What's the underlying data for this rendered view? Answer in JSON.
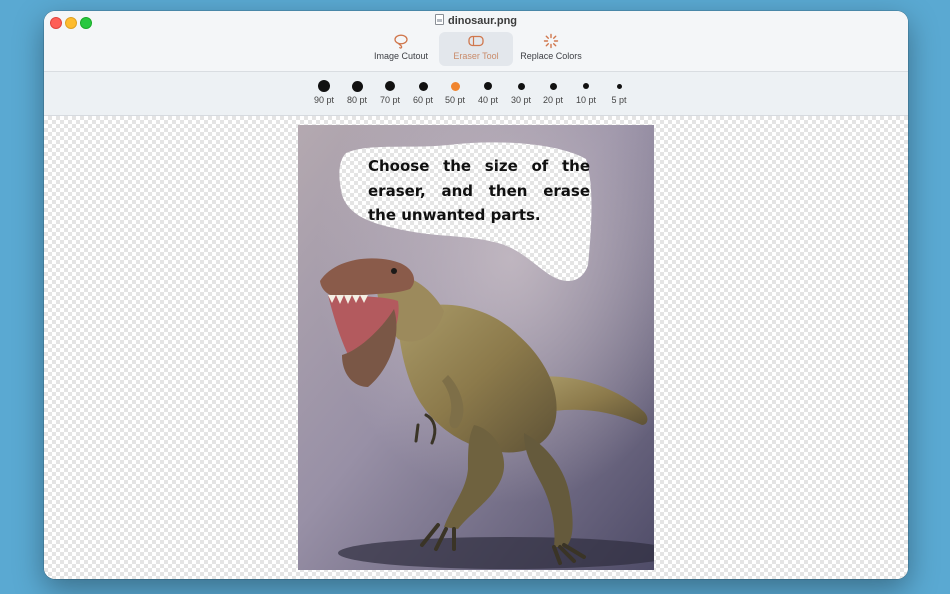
{
  "window": {
    "filename": "dinosaur.png"
  },
  "toolbar": {
    "tools": [
      {
        "label": "Image Cutout",
        "icon": "lasso-icon",
        "selected": false
      },
      {
        "label": "Eraser Tool",
        "icon": "eraser-icon",
        "selected": true
      },
      {
        "label": "Replace Colors",
        "icon": "sparkle-icon",
        "selected": false
      }
    ]
  },
  "eraser_sizes": {
    "options": [
      "90 pt",
      "80 pt",
      "70 pt",
      "60 pt",
      "50 pt",
      "40 pt",
      "30 pt",
      "20 pt",
      "10 pt",
      "5 pt"
    ],
    "selected": "50 pt",
    "selected_color": "#f0852f"
  },
  "image": {
    "caption": "Choose the size of the eraser, and then erase the unwanted parts."
  },
  "colors": {
    "desktop": "#5aa9d2",
    "accent_selected_tool": "#c98b6a"
  }
}
